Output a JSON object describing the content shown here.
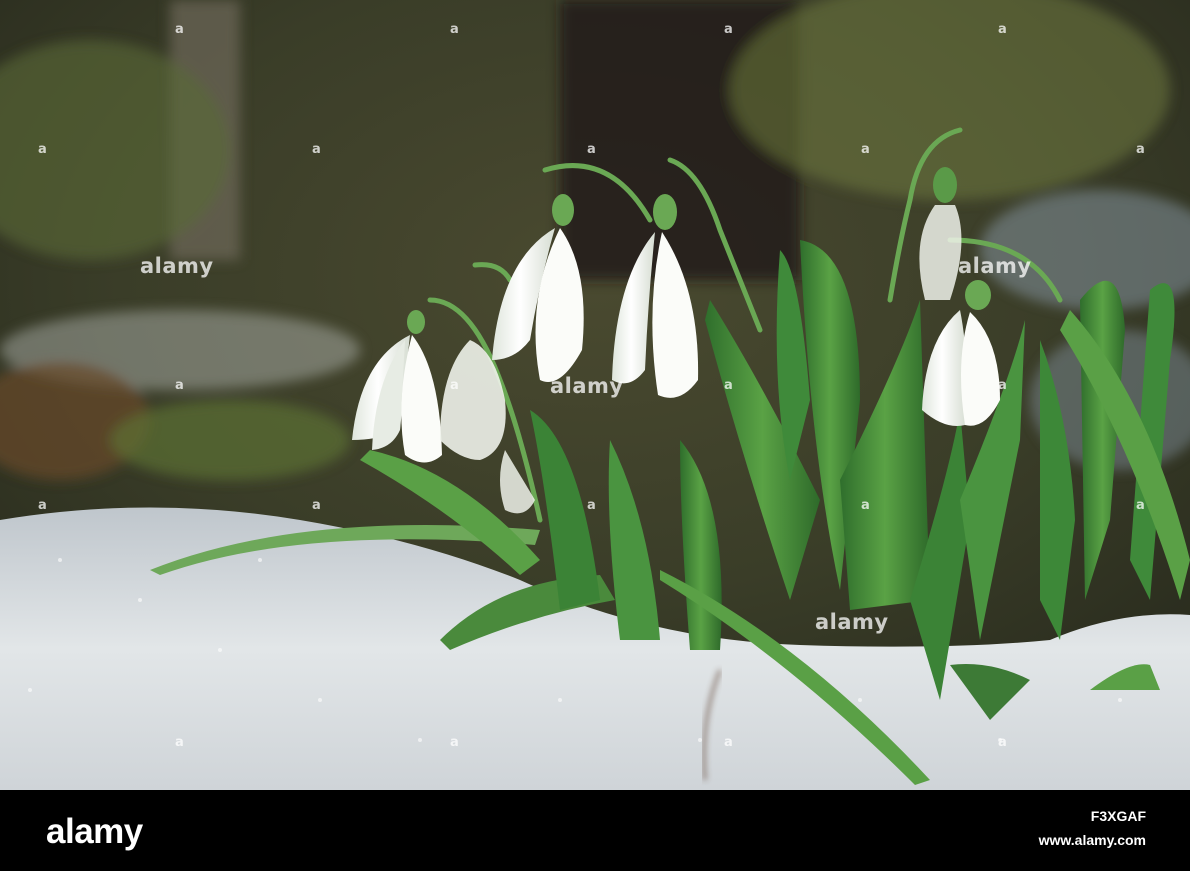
{
  "scene": {
    "description_tag": "snowdrop-flowers-in-melting-snow",
    "colors": {
      "background_dark": "#2a2a20",
      "background_green": "#55603a",
      "leaf": "#3f8a3a",
      "leaf_light": "#7dbb5e",
      "petal": "#f4f6f2",
      "snow": "#d9dde0"
    }
  },
  "watermark": {
    "mark": "a",
    "word": "alamy"
  },
  "footer": {
    "brand": "alamy",
    "image_id": "F3XGAF",
    "site": "www.alamy.com"
  }
}
